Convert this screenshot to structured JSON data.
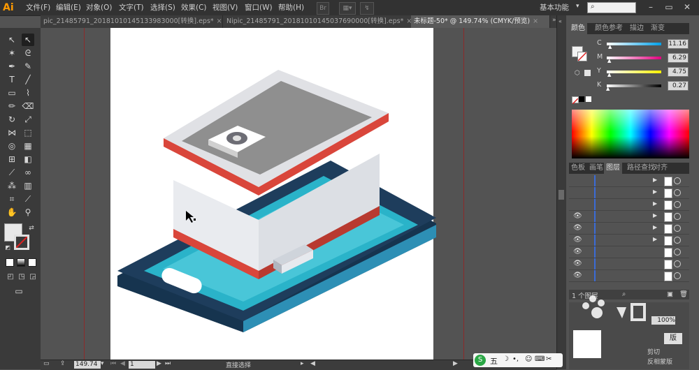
{
  "app": {
    "logo": "Ai",
    "workspace": "基本功能",
    "search_placeholder": ""
  },
  "menu": [
    "文件(F)",
    "编辑(E)",
    "对象(O)",
    "文字(T)",
    "选择(S)",
    "效果(C)",
    "视图(V)",
    "窗口(W)",
    "帮助(H)"
  ],
  "toolbar_extras": {
    "br": "Br"
  },
  "tabs": [
    {
      "label": "pic_21485791_20181010145133983000[转换].eps*",
      "close": "×",
      "active": false
    },
    {
      "label": "Nipic_21485791_20181010145037690000[转换].eps*",
      "close": "×",
      "active": false
    },
    {
      "label": "未标题-50* @ 149.74% (CMYK/预览)",
      "close": "×",
      "active": true
    }
  ],
  "color_panel": {
    "tabs": [
      "颜色",
      "颜色参考",
      "描边",
      "渐变"
    ],
    "channels": [
      {
        "label": "C",
        "value": "11.16",
        "color_from": "#ffffff",
        "color_to": "#00a0e9",
        "percent": 11.16
      },
      {
        "label": "M",
        "value": "6.29",
        "color_from": "#ffffff",
        "color_to": "#e4007f",
        "percent": 6.29
      },
      {
        "label": "Y",
        "value": "4.75",
        "color_from": "#ffffff",
        "color_to": "#fff100",
        "percent": 4.75
      },
      {
        "label": "K",
        "value": "0.27",
        "color_from": "#ffffff",
        "color_to": "#000000",
        "percent": 0.27
      }
    ]
  },
  "layers_panel": {
    "tabs": [
      "色板",
      "画笔",
      "图层",
      "路径查找",
      "对齐"
    ],
    "active_tab": "图层",
    "footer_label": "1 个图层"
  },
  "transparency": {
    "percent_label": "100%",
    "buttons": [
      "版"
    ],
    "options": [
      "剪切",
      "反相蒙版"
    ]
  },
  "statusbar": {
    "zoom": "149.74",
    "page": "1",
    "tool": "直接选择"
  },
  "colors": {
    "accent_red": "#d9463b",
    "phone_dark": "#1e3d5c",
    "phone_teal": "#2ab3c9",
    "building_light": "#e9ebef",
    "roof_gray": "#8f8f8f"
  }
}
